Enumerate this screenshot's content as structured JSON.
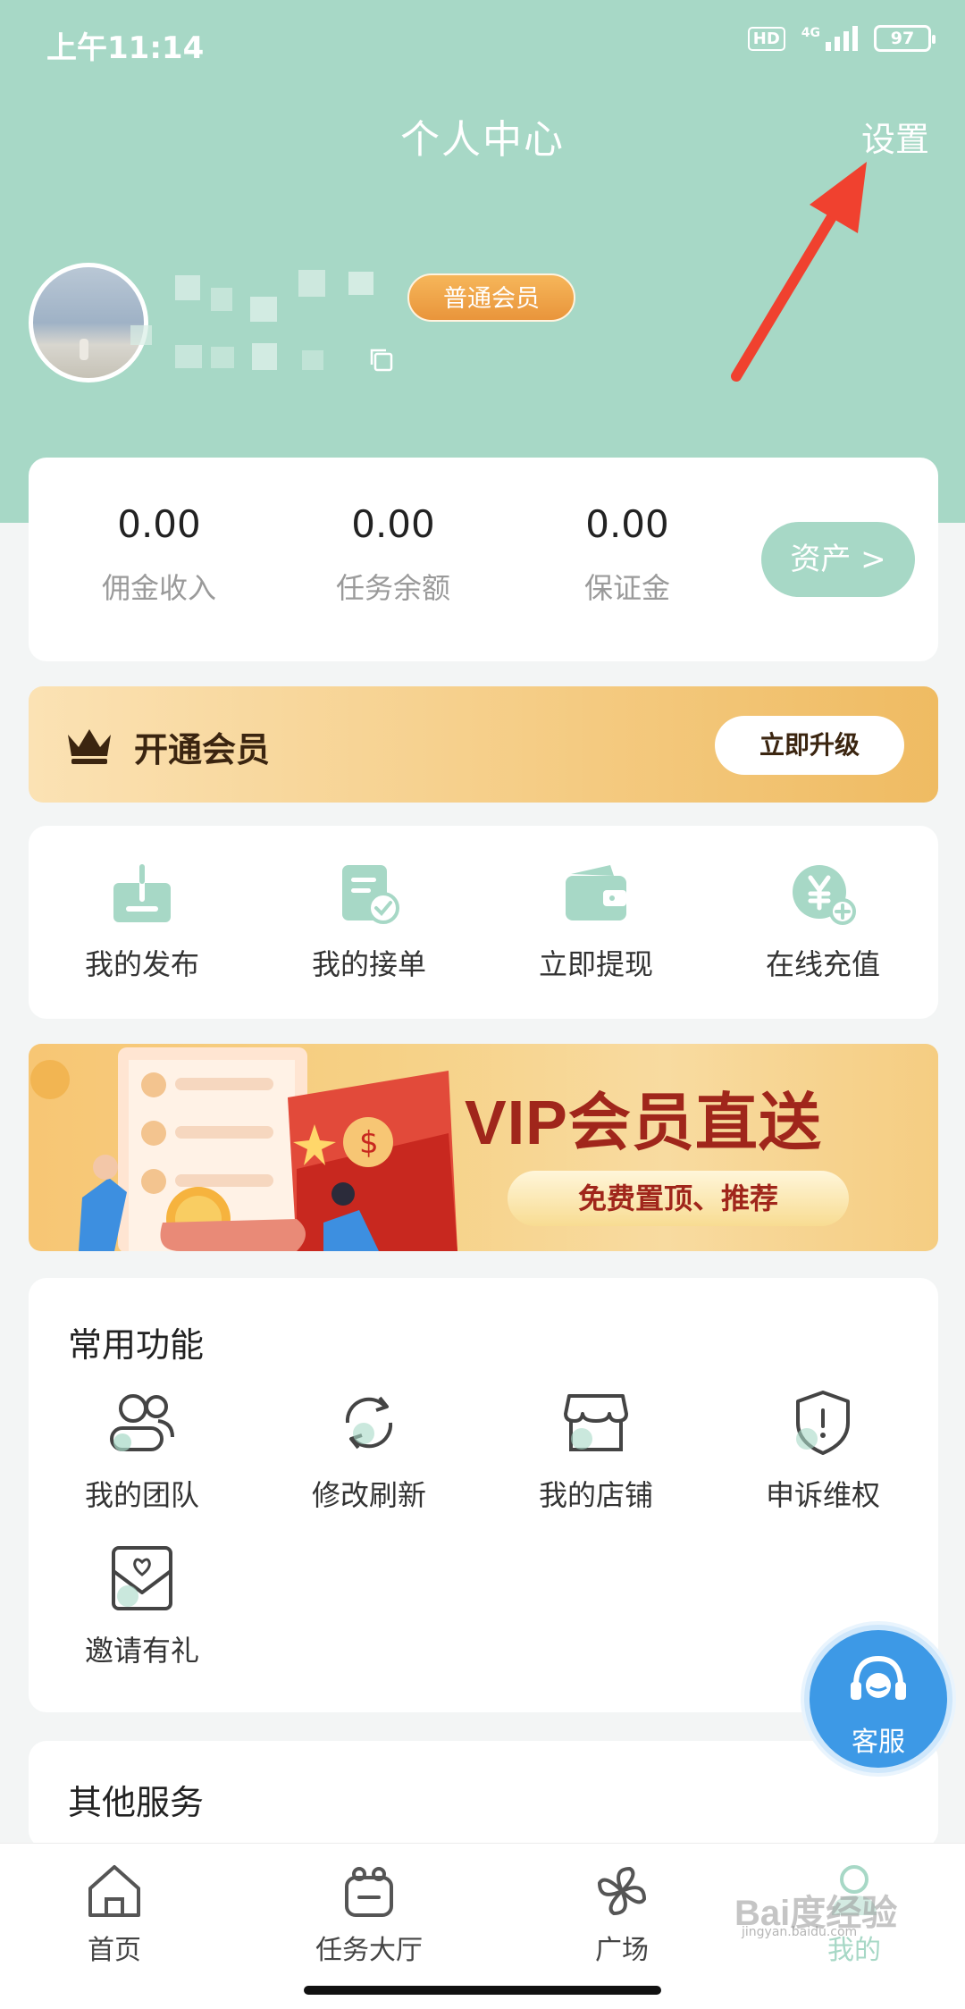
{
  "status": {
    "time": "上午11:14",
    "hd": "HD",
    "network": "4G",
    "battery": "97"
  },
  "header": {
    "title": "个人中心",
    "settings": "设置"
  },
  "profile": {
    "member_level": "普通会员"
  },
  "assets": {
    "items": [
      {
        "value": "0.00",
        "label": "佣金收入"
      },
      {
        "value": "0.00",
        "label": "任务余额"
      },
      {
        "value": "0.00",
        "label": "保证金"
      }
    ],
    "button": "资产 >"
  },
  "vip": {
    "title": "开通会员",
    "button": "立即升级"
  },
  "quick": [
    {
      "label": "我的发布",
      "icon": "upload-icon"
    },
    {
      "label": "我的接单",
      "icon": "order-check-icon"
    },
    {
      "label": "立即提现",
      "icon": "wallet-icon"
    },
    {
      "label": "在线充值",
      "icon": "recharge-icon"
    }
  ],
  "banner": {
    "title": "VIP会员直送",
    "subtitle": "免费置顶、推荐"
  },
  "common": {
    "title": "常用功能",
    "items": [
      {
        "label": "我的团队",
        "icon": "team-icon"
      },
      {
        "label": "修改刷新",
        "icon": "refresh-icon"
      },
      {
        "label": "我的店铺",
        "icon": "store-icon"
      },
      {
        "label": "申诉维权",
        "icon": "shield-alert-icon"
      },
      {
        "label": "邀请有礼",
        "icon": "invite-mail-icon"
      }
    ]
  },
  "other": {
    "title": "其他服务"
  },
  "service": {
    "label": "客服"
  },
  "tabs": [
    {
      "label": "首页",
      "icon": "home-icon"
    },
    {
      "label": "任务大厅",
      "icon": "task-hall-icon"
    },
    {
      "label": "广场",
      "icon": "pinwheel-icon"
    },
    {
      "label": "我的",
      "icon": "user-icon"
    }
  ],
  "watermark": {
    "text": "Bai度经验",
    "sub": "jingyan.baidu.com"
  },
  "colors": {
    "header_bg": "#a7d8c6",
    "accent": "#a7d8c6",
    "member_badge": "#f0a045",
    "service": "#3d99e6",
    "arrow": "#f0412f"
  }
}
